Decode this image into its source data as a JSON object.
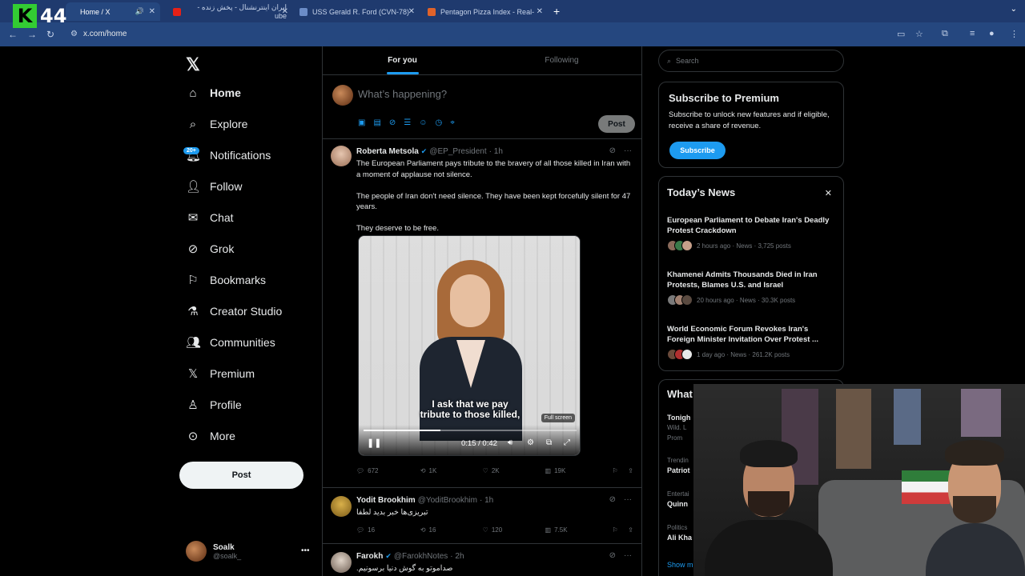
{
  "browser": {
    "brand": {
      "letter": "K",
      "number": "44"
    },
    "tabs": [
      {
        "title": "Home / X",
        "active": true,
        "sound": true
      },
      {
        "title": "ایران اینترنشنال - پخش زنده - ube",
        "active": false
      },
      {
        "title": "USS Gerald R. Ford (CVN-78)",
        "active": false
      },
      {
        "title": "Pentagon Pizza Index - Real-",
        "active": false
      }
    ],
    "url": "x.com/home"
  },
  "sidebar": {
    "items": [
      {
        "label": "Home",
        "icon": "home-icon"
      },
      {
        "label": "Explore",
        "icon": "search-icon"
      },
      {
        "label": "Notifications",
        "icon": "bell-icon"
      },
      {
        "label": "Follow",
        "icon": "follow-icon"
      },
      {
        "label": "Chat",
        "icon": "mail-icon"
      },
      {
        "label": "Grok",
        "icon": "grok-icon"
      },
      {
        "label": "Bookmarks",
        "icon": "bookmark-icon"
      },
      {
        "label": "Creator Studio",
        "icon": "flask-icon"
      },
      {
        "label": "Communities",
        "icon": "communities-icon"
      },
      {
        "label": "Premium",
        "icon": "x-icon"
      },
      {
        "label": "Profile",
        "icon": "person-icon"
      },
      {
        "label": "More",
        "icon": "more-circle-icon"
      }
    ],
    "notifications_badge": "20+",
    "post_label": "Post",
    "profile": {
      "name": "Soalk",
      "handle": "@soalk_"
    }
  },
  "feed": {
    "tabs": [
      "For you",
      "Following"
    ],
    "composer_placeholder": "What’s happening?",
    "composer_post": "Post",
    "tweets": [
      {
        "name": "Roberta Metsola",
        "handle": "@EP_President",
        "time": "· 1h",
        "text": "The European Parliament pays tribute to the bravery of all those killed in Iran with a moment of applause not silence.\n\nThe people of Iran don't need silence. They have been kept forcefully silent for 47 years.\n\nThey deserve to be free.",
        "video": {
          "subtitle": "I ask that we pay\ntribute to those killed,",
          "time": "0:15 / 0:42",
          "progress": 0.36,
          "fullscreen_tip": "Full screen"
        },
        "stats": {
          "replies": "672",
          "reposts": "1K",
          "likes": "2K",
          "views": "19K"
        }
      },
      {
        "name": "Yodit Brookhim",
        "handle": "@YoditBrookhim",
        "time": "· 1h",
        "text": "تبریزی‌ها خبر بدید لطفا",
        "stats": {
          "replies": "16",
          "reposts": "16",
          "likes": "120",
          "views": "7.5K"
        }
      },
      {
        "name": "Farokh",
        "handle": "@FarokhNotes",
        "time": "· 2h",
        "text": "صداموتو به گوش دنیا برسونیم."
      }
    ]
  },
  "right": {
    "search_placeholder": "Search",
    "premium": {
      "title": "Subscribe to Premium",
      "text": "Subscribe to unlock new features and if eligible, receive a share of revenue.",
      "button": "Subscribe"
    },
    "news": {
      "title": "Today’s News",
      "items": [
        {
          "title": "European Parliament to Debate Iran's Deadly Protest Crackdown",
          "meta": "2 hours ago · News · 3,725 posts"
        },
        {
          "title": "Khamenei Admits Thousands Died in Iran Protests, Blames U.S. and Israel",
          "meta": "20 hours ago · News · 30.3K posts"
        },
        {
          "title": "World Economic Forum Revokes Iran's Foreign Minister Invitation Over Protest ...",
          "meta": "1 day ago · News · 261.2K posts"
        }
      ]
    },
    "partial": {
      "heading": "What",
      "t1": "Tonigh",
      "t1b": "Wild. L",
      "t1c": "Prom",
      "t2a": "Trendin",
      "t2": "Patriot",
      "t3a": "Entertai",
      "t3": "Quinn",
      "t4a": "Politics",
      "t4": "Ali Kha",
      "more": "Show m"
    }
  }
}
